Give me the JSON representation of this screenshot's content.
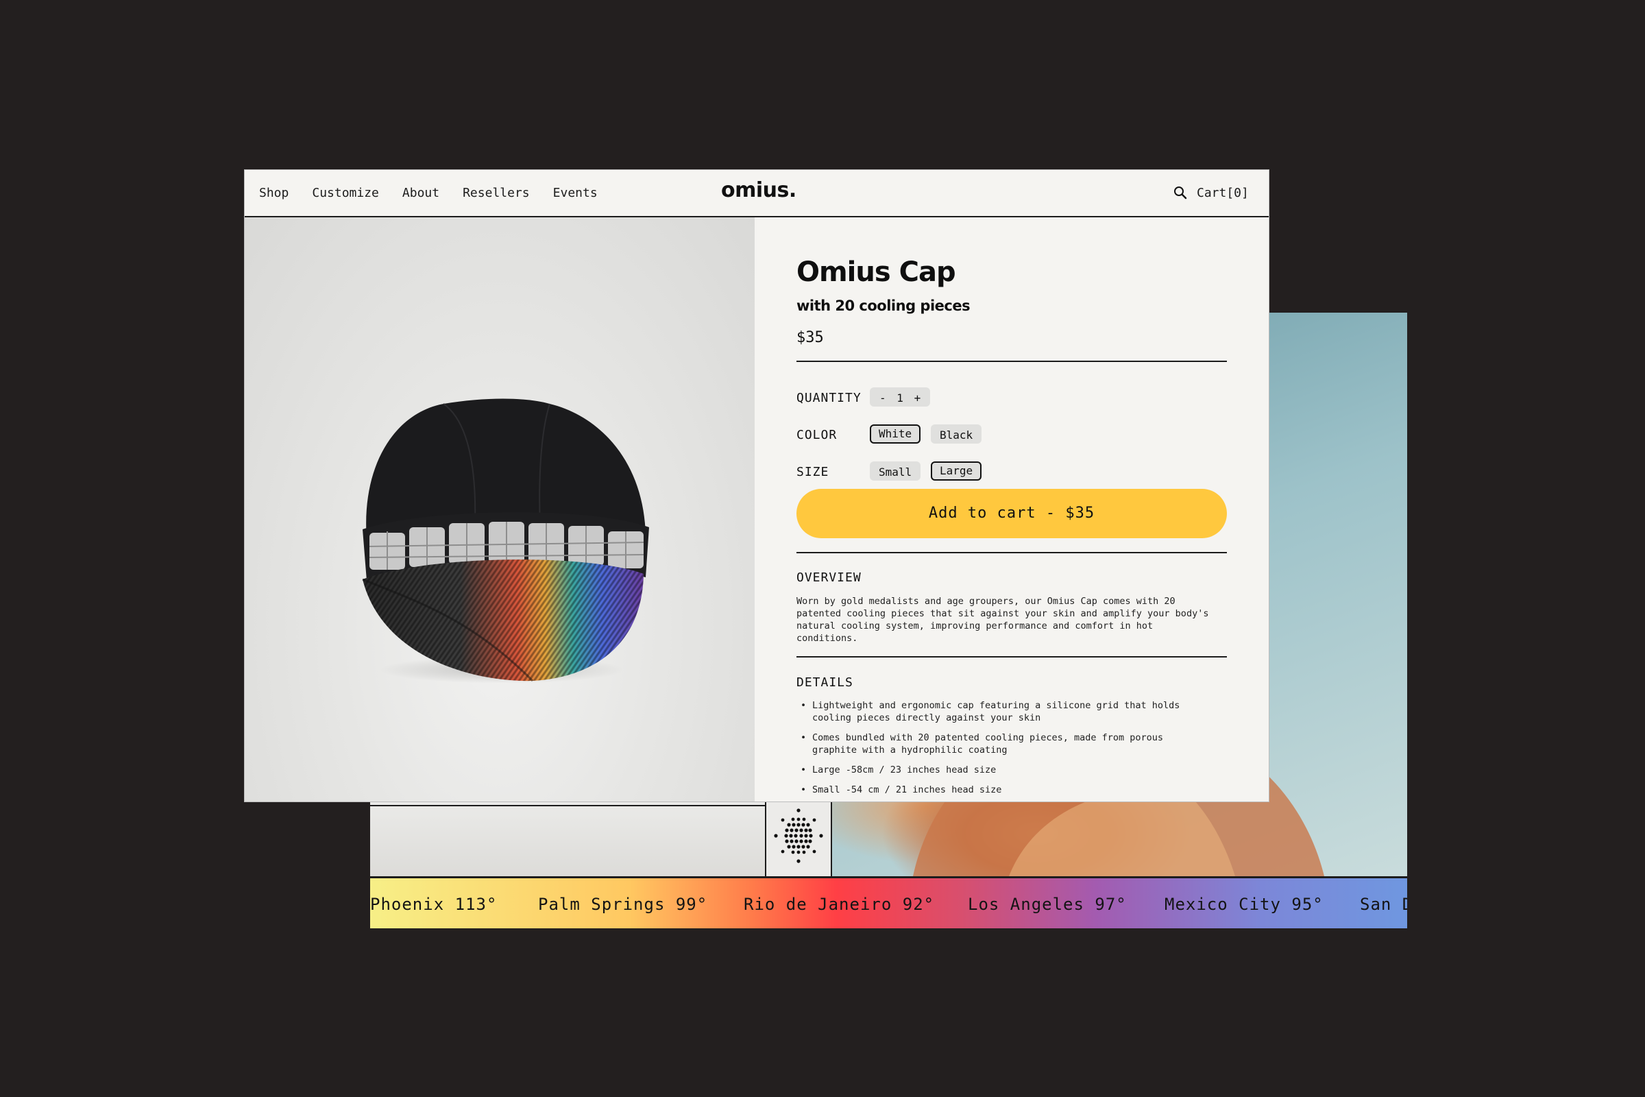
{
  "nav": {
    "links": [
      "Shop",
      "Customize",
      "About",
      "Resellers",
      "Events"
    ],
    "brand": "omius.",
    "search_icon": "search-icon",
    "cart": "Cart[0]"
  },
  "product": {
    "title": "Omius Cap",
    "subtitle": "with 20 cooling pieces",
    "price": "$35",
    "image": "black-cap-with-cooling-grid-product-photo"
  },
  "options": {
    "quantity_label": "QUANTITY",
    "quantity_minus": "-",
    "quantity_value": "1",
    "quantity_plus": "+",
    "color_label": "COLOR",
    "colors": [
      "White",
      "Black"
    ],
    "color_selected": "White",
    "size_label": "SIZE",
    "sizes": [
      "Small",
      "Large"
    ],
    "size_selected": "Large"
  },
  "cta": {
    "label": "Add to cart - $35",
    "color": "#ffc83e"
  },
  "overview": {
    "title": "OVERVIEW",
    "text": "Worn by gold medalists and age groupers, our Omius Cap comes with 20 patented cooling pieces that sit against your skin and amplify your body's natural cooling system, improving performance and comfort in hot conditions."
  },
  "details": {
    "title": "DETAILS",
    "items": [
      "Lightweight and ergonomic cap featuring a silicone grid that holds cooling pieces directly against your skin",
      "Comes bundled with 20 patented cooling pieces, made from porous graphite with a hydrophilic coating",
      "Large -58cm / 23 inches head size",
      "Small -54 cm / 21 inches head size"
    ]
  },
  "ticker": {
    "items": [
      "Phoenix 113°",
      "Palm Springs 99°",
      "Rio de Janeiro 92°",
      "Los Angeles 97°",
      "Mexico City 95°",
      "San D"
    ]
  },
  "colors": {
    "background": "#231f1f",
    "panel": "#f5f4f1",
    "accent": "#ffc83e"
  }
}
